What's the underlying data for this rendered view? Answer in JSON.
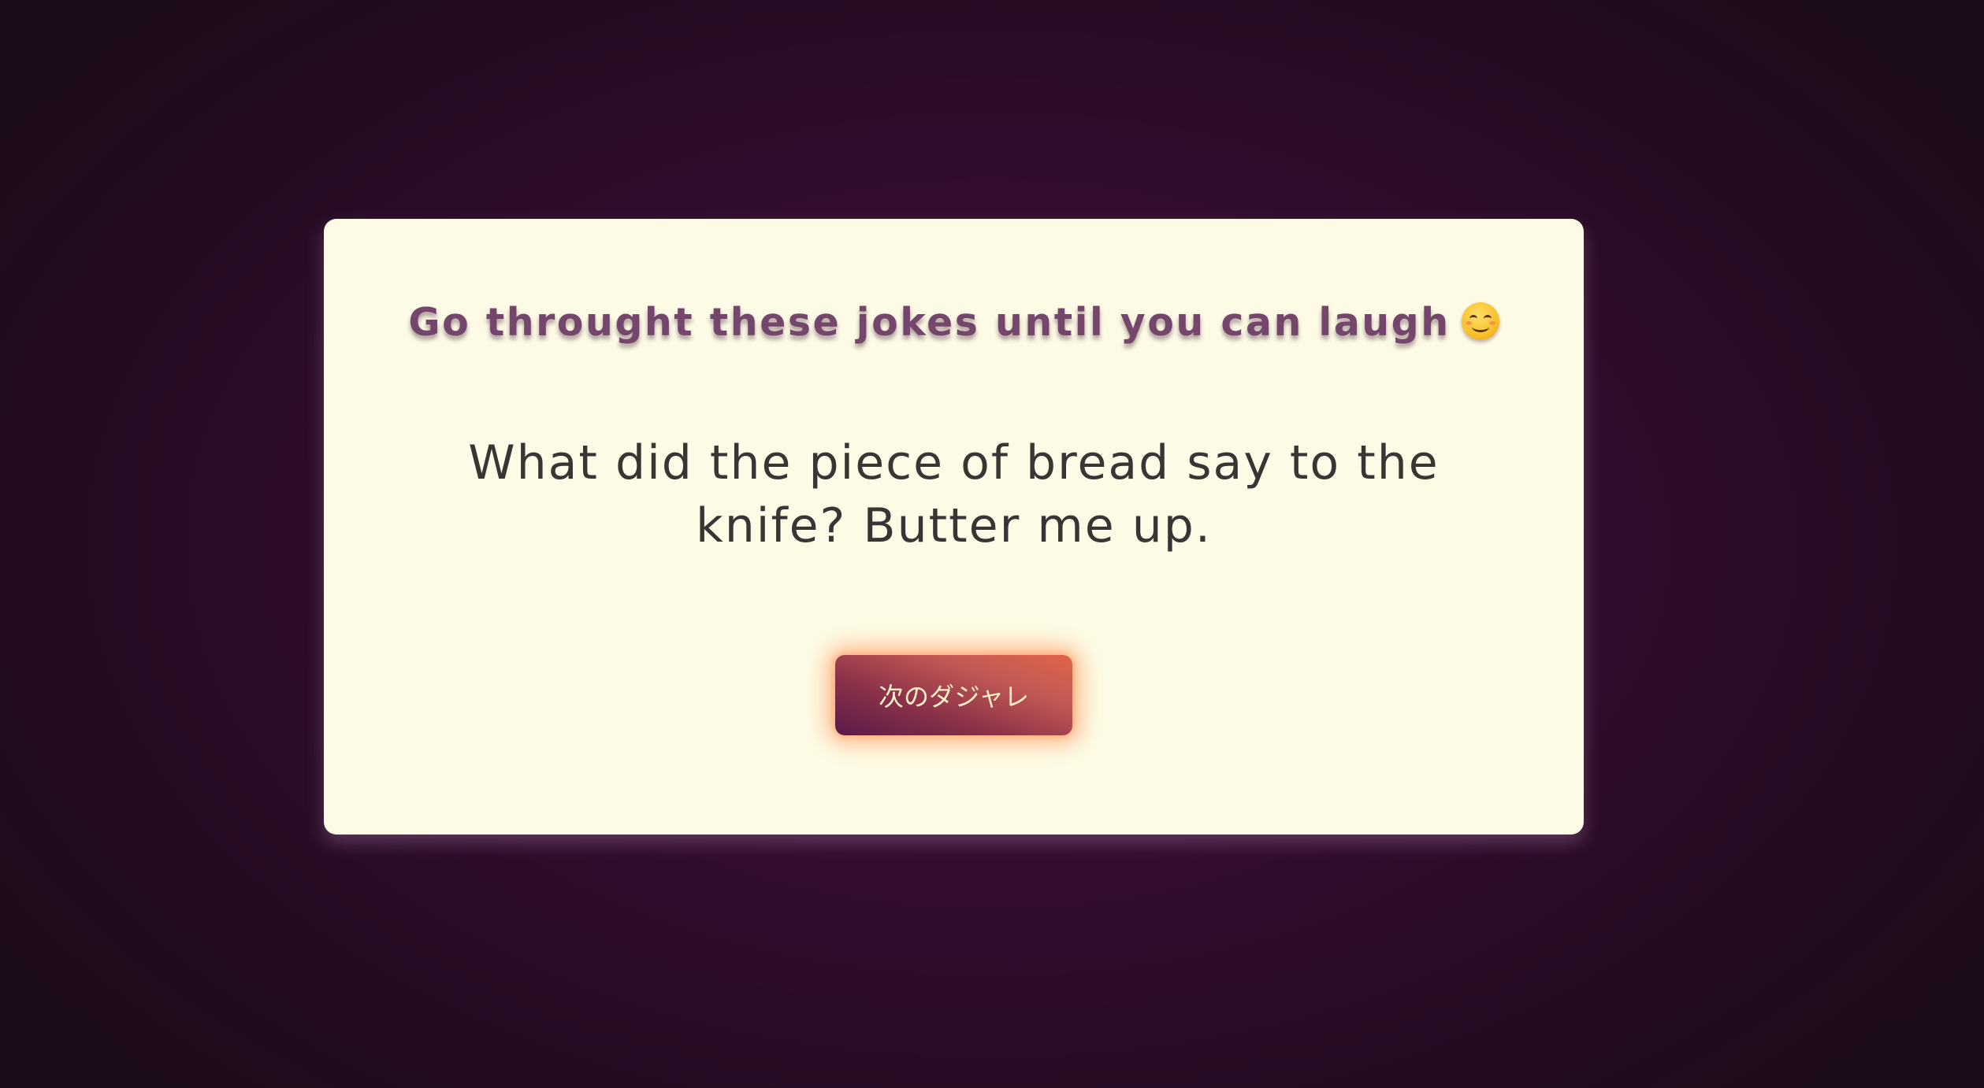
{
  "card": {
    "title": "Go throught these jokes until you can laugh",
    "title_emoji": "😊",
    "joke": "What did the piece of bread say to the knife? Butter me up.",
    "next_button_label": "次のダジャレ"
  },
  "colors": {
    "background": "#3c0f39",
    "card": "#fdfbe6",
    "title": "#74466c",
    "joke_text": "#3a3535",
    "button_glow": "#ff8a3c"
  }
}
